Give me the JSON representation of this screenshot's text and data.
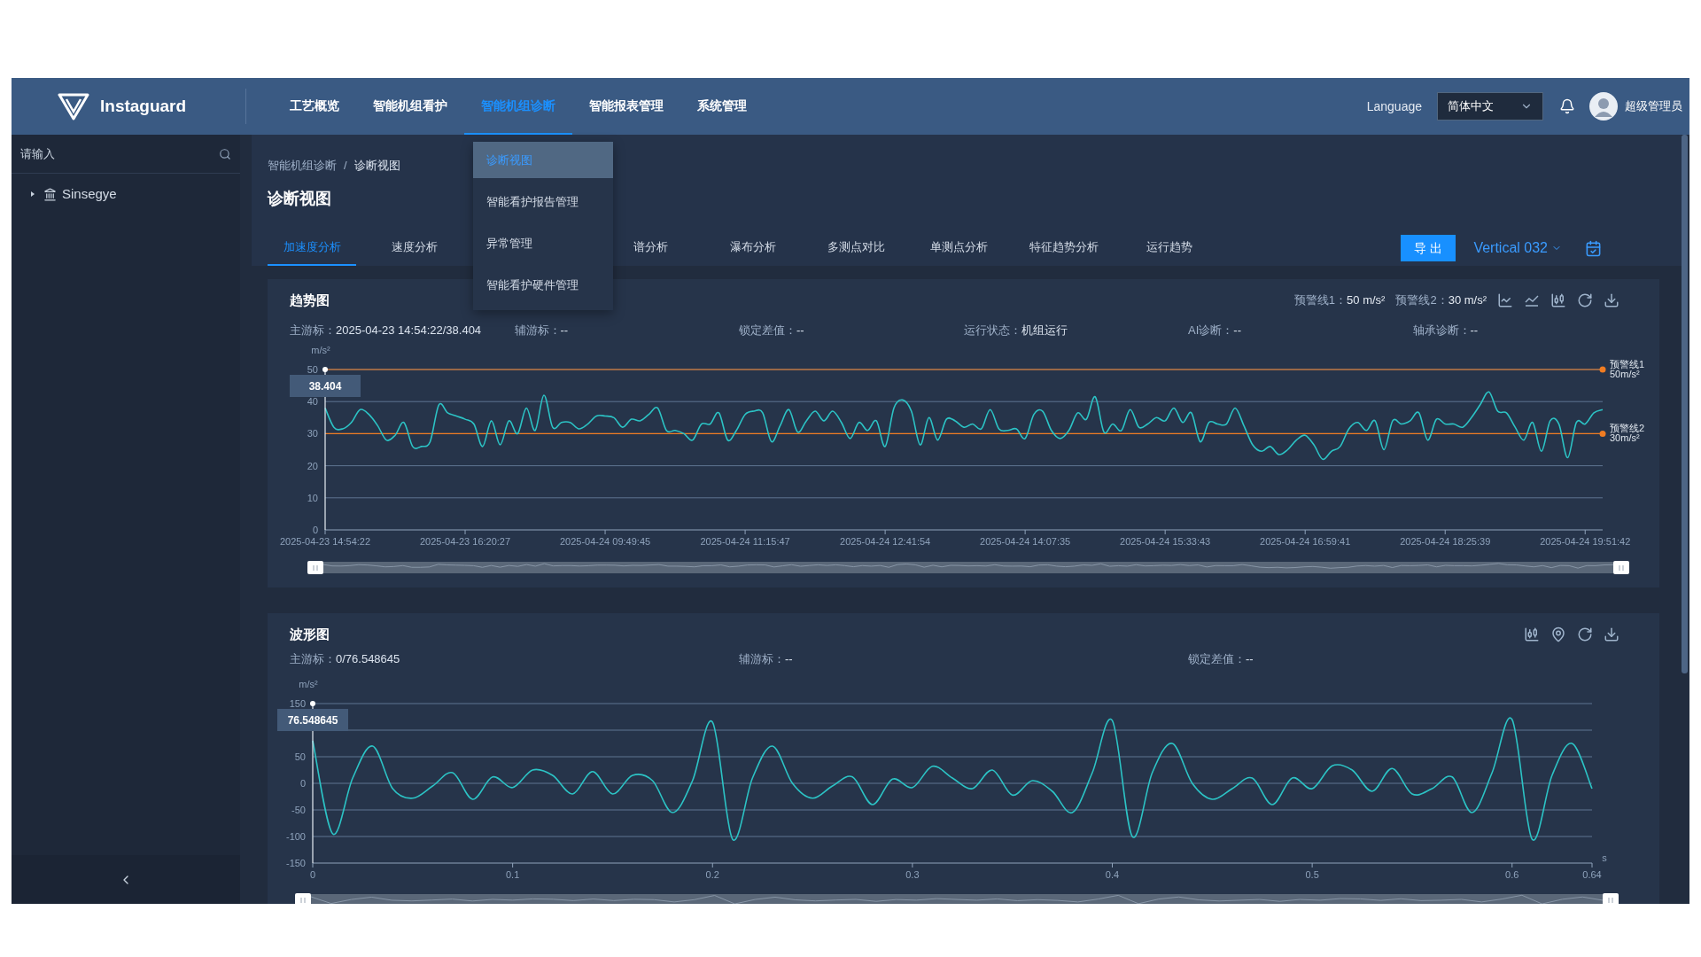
{
  "header": {
    "brand": "Instaguard",
    "nav": [
      {
        "label": "工艺概览",
        "selected": false
      },
      {
        "label": "智能机组看护",
        "selected": false
      },
      {
        "label": "智能机组诊断",
        "selected": true
      },
      {
        "label": "智能报表管理",
        "selected": false
      },
      {
        "label": "系统管理",
        "selected": false
      }
    ],
    "language_label": "Language",
    "language": "简体中文",
    "user": "超级管理员"
  },
  "nav_menu": {
    "items": [
      {
        "label": "诊断视图",
        "selected": true
      },
      {
        "label": "智能看护报告管理",
        "selected": false
      },
      {
        "label": "异常管理",
        "selected": false
      },
      {
        "label": "智能看护硬件管理",
        "selected": false
      }
    ]
  },
  "sidebar": {
    "search": {
      "placeholder": "请输入"
    },
    "tree": [
      {
        "label": "Sinsegye",
        "expanded": false
      }
    ]
  },
  "breadcrumb": {
    "items": [
      "智能机组诊断",
      "诊断视图"
    ],
    "separator": "/"
  },
  "page_title": "诊断视图",
  "tabs": [
    {
      "label": "加速度分析",
      "selected": true
    },
    {
      "label": "速度分析",
      "selected": false
    },
    {
      "label": "谱分析",
      "selected": false
    },
    {
      "label": "瀑布分析",
      "selected": false
    },
    {
      "label": "多测点对比",
      "selected": false
    },
    {
      "label": "单测点分析",
      "selected": false
    },
    {
      "label": "特征趋势分析",
      "selected": false
    },
    {
      "label": "运行趋势",
      "selected": false
    }
  ],
  "toolbar": {
    "export": "导 出",
    "point": "Vertical 032"
  },
  "trend_card": {
    "title": "趋势图",
    "warnings": [
      {
        "label": "预警线1：",
        "value": "50 m/s²"
      },
      {
        "label": "预警线2：",
        "value": "30 m/s²"
      }
    ],
    "info": [
      {
        "label": "主游标：",
        "value": "2025-04-23 14:54:22/38.404"
      },
      {
        "label": "辅游标：",
        "value": "--"
      },
      {
        "label": "锁定差值：",
        "value": "--"
      },
      {
        "label": "运行状态：",
        "value": "机组运行"
      },
      {
        "label": "AI诊断：",
        "value": "--"
      },
      {
        "label": "轴承诊断：",
        "value": "--"
      }
    ],
    "cursor": {
      "value": "38.404"
    },
    "chart_data": {
      "type": "line",
      "ylabel": "m/s²",
      "grid": true,
      "ylim": [
        0,
        50
      ],
      "yticks": [
        0,
        10,
        20,
        30,
        40,
        50
      ],
      "categories": [
        "2025-04-23 14:54:22",
        null,
        null,
        null,
        null,
        null,
        null,
        null,
        null,
        null,
        null,
        null,
        null,
        null,
        null,
        null,
        "2025-04-23 16:20:27",
        null,
        null,
        null,
        null,
        null,
        null,
        null,
        null,
        null,
        null,
        null,
        null,
        null,
        null,
        null,
        "2025-04-24 09:49:45",
        null,
        null,
        null,
        null,
        null,
        null,
        null,
        null,
        null,
        null,
        null,
        null,
        null,
        null,
        null,
        "2025-04-24 11:15:47",
        null,
        null,
        null,
        null,
        null,
        null,
        null,
        null,
        null,
        null,
        null,
        null,
        null,
        null,
        null,
        "2025-04-24 12:41:54",
        null,
        null,
        null,
        null,
        null,
        null,
        null,
        null,
        null,
        null,
        null,
        null,
        null,
        null,
        null,
        "2025-04-24 14:07:35",
        null,
        null,
        null,
        null,
        null,
        null,
        null,
        null,
        null,
        null,
        null,
        null,
        null,
        null,
        null,
        "2025-04-24 15:33:43",
        null,
        null,
        null,
        null,
        null,
        null,
        null,
        null,
        null,
        null,
        null,
        null,
        null,
        null,
        null,
        "2025-04-24 16:59:41",
        null,
        null,
        null,
        null,
        null,
        null,
        null,
        null,
        null,
        null,
        null,
        null,
        null,
        null,
        null,
        "2025-04-24 18:25:39",
        null,
        null,
        null,
        null,
        null,
        null,
        null,
        null,
        null,
        null,
        null,
        null,
        null,
        null,
        null,
        "2025-04-24 19:51:42",
        null,
        null
      ],
      "series": [
        {
          "color": "#2cc3c5",
          "values": [
            38,
            32,
            31.5,
            33.5,
            37.5,
            36,
            32.5,
            28,
            29.5,
            33.5,
            26,
            26,
            27.5,
            39,
            36.5,
            35.5,
            34.5,
            33,
            26,
            34,
            26.5,
            34,
            30,
            38,
            31,
            42,
            32,
            33.5,
            33.5,
            31.5,
            33,
            35.5,
            35.5,
            35,
            32,
            34.5,
            34,
            36,
            38,
            31,
            31,
            30,
            28,
            33,
            33,
            36.5,
            28,
            31,
            36,
            37,
            36.5,
            27.5,
            32.5,
            37.5,
            30.5,
            34,
            37,
            34,
            37,
            33.5,
            28.5,
            33.5,
            31,
            34,
            26,
            38,
            40.5,
            37,
            26.5,
            35,
            28,
            34.5,
            34,
            32,
            33,
            31.5,
            37.5,
            31.5,
            31,
            31.5,
            28.5,
            36,
            37,
            31,
            28.5,
            31,
            36.5,
            34.5,
            41.5,
            30.5,
            33,
            31,
            37.5,
            32,
            33,
            35,
            34,
            38,
            33.5,
            36.5,
            27.5,
            33.5,
            33,
            33,
            38,
            32.5,
            26.5,
            24.5,
            26,
            23.5,
            25,
            28,
            29.5,
            26.5,
            22,
            24.5,
            26,
            31.5,
            33.5,
            31,
            34,
            25,
            34,
            33,
            34,
            36.5,
            28,
            34.5,
            33,
            33,
            32,
            35,
            39,
            43,
            37,
            36.5,
            32,
            28,
            33.5,
            24.5,
            34,
            33,
            22.5,
            33.5,
            33,
            36.5,
            37.5
          ]
        }
      ],
      "ref_lines": [
        {
          "axis": "y",
          "value": 50,
          "label": "预警线1\n50m/s²"
        },
        {
          "axis": "y",
          "value": 30,
          "label": "预警线2\n30m/s²"
        }
      ]
    }
  },
  "wave_card": {
    "title": "波形图",
    "info": [
      {
        "label": "主游标：",
        "value": "0/76.548645"
      },
      {
        "label": "辅游标：",
        "value": "--"
      },
      {
        "label": "锁定差值：",
        "value": "--"
      }
    ],
    "cursor": {
      "value": "76.548645"
    },
    "chart_data": {
      "type": "line",
      "ylabel": "m/s²",
      "xlabel": "s",
      "grid": true,
      "xlim": [
        0,
        0.64
      ],
      "ylim": [
        -150,
        150
      ],
      "yticks": [
        -150,
        -100,
        -50,
        0,
        50,
        150
      ],
      "xticks": [
        0,
        0.1,
        0.2,
        0.3,
        0.4,
        0.5,
        0.6,
        0.64
      ],
      "x": [
        0,
        0.01,
        0.02,
        0.03,
        0.04,
        0.05,
        0.06,
        0.07,
        0.08,
        0.09,
        0.1,
        0.11,
        0.12,
        0.13,
        0.14,
        0.15,
        0.16,
        0.17,
        0.18,
        0.19,
        0.2,
        0.21,
        0.22,
        0.23,
        0.24,
        0.25,
        0.26,
        0.27,
        0.28,
        0.29,
        0.3,
        0.31,
        0.32,
        0.33,
        0.34,
        0.35,
        0.36,
        0.37,
        0.38,
        0.39,
        0.4,
        0.41,
        0.42,
        0.43,
        0.44,
        0.45,
        0.46,
        0.47,
        0.48,
        0.49,
        0.5,
        0.51,
        0.52,
        0.53,
        0.54,
        0.55,
        0.56,
        0.57,
        0.58,
        0.59,
        0.6,
        0.61,
        0.62,
        0.63,
        0.64
      ],
      "series": [
        {
          "color": "#2cc3c5",
          "values": [
            80,
            -95,
            10,
            70,
            -10,
            -28,
            -5,
            20,
            -30,
            12,
            -8,
            25,
            15,
            -20,
            22,
            -20,
            15,
            5,
            -55,
            5,
            115,
            -105,
            10,
            70,
            0,
            -28,
            -5,
            12,
            -40,
            8,
            -8,
            32,
            10,
            -10,
            25,
            -22,
            5,
            -15,
            -55,
            20,
            118,
            -100,
            20,
            75,
            0,
            -30,
            -10,
            10,
            -40,
            10,
            -10,
            33,
            25,
            -15,
            28,
            -20,
            -10,
            12,
            -55,
            20,
            120,
            -105,
            15,
            75,
            -10
          ]
        }
      ]
    }
  }
}
